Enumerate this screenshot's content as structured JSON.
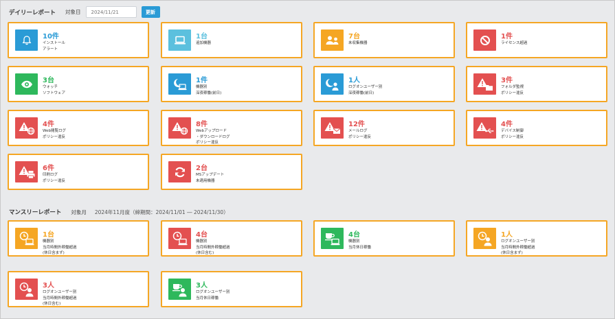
{
  "daily": {
    "title": "デイリーレポート",
    "target_label": "対象日",
    "date_placeholder": "2024/11/21",
    "update_label": "更新"
  },
  "monthly": {
    "title": "マンスリーレポート",
    "target_label": "対象月",
    "period": "2024年11月度（締期間：2024/11/01 ― 2024/11/30）"
  },
  "colors": {
    "red": "#e35050",
    "blue": "#2a9bd6",
    "light_blue": "#5bc0de",
    "orange": "#f5a623",
    "green": "#2eb85c",
    "card_border": "#f5a623"
  },
  "daily_cards": [
    {
      "value": "10件",
      "desc": "インストール\nアラート",
      "color": "blue",
      "icon": "bell-icon"
    },
    {
      "value": "1台",
      "desc": "追加機器",
      "color": "light-blue",
      "icon": "laptop-icon"
    },
    {
      "value": "7台",
      "desc": "未収集機器",
      "color": "orange",
      "icon": "users-icon"
    },
    {
      "value": "1件",
      "desc": "ライセンス超過",
      "color": "red",
      "icon": "ban-icon"
    },
    {
      "value": "3台",
      "desc": "ウォッチ\nソフトウェア",
      "color": "green",
      "icon": "eye-icon"
    },
    {
      "value": "1件",
      "desc": "機器別\n深夜稼働(前日)",
      "color": "blue",
      "icon": "moon-laptop-icon"
    },
    {
      "value": "1人",
      "desc": "ログオンユーザー別\n深夜稼働(前日)",
      "color": "blue",
      "icon": "moon-user-icon"
    },
    {
      "value": "3件",
      "desc": "フォルダ監視\nポリシー違反",
      "color": "red",
      "icon": "warning-folder-icon"
    },
    {
      "value": "4件",
      "desc": "Web閲覧ログ\nポリシー違反",
      "color": "red",
      "icon": "warning-globe-icon"
    },
    {
      "value": "8件",
      "desc": "Webアップロード\n・ダウンロードログ\nポリシー違反",
      "color": "red",
      "icon": "warning-globe-icon"
    },
    {
      "value": "12件",
      "desc": "メールログ\nポリシー違反",
      "color": "red",
      "icon": "warning-mail-icon"
    },
    {
      "value": "4件",
      "desc": "デバイス制御\nポリシー違反",
      "color": "red",
      "icon": "warning-usb-icon"
    },
    {
      "value": "6件",
      "desc": "印刷ログ\nポリシー違反",
      "color": "red",
      "icon": "warning-printer-icon"
    },
    {
      "value": "2台",
      "desc": "MSアップデート\n未適用機器",
      "color": "red",
      "icon": "refresh-icon"
    }
  ],
  "monthly_cards": [
    {
      "value": "1台",
      "desc": "機器別\n当月時間外稼働超過\n(休日含まず)",
      "color": "orange",
      "icon": "clock-laptop-icon"
    },
    {
      "value": "4台",
      "desc": "機器別\n当月時間外稼働超過\n(休日含む)",
      "color": "red",
      "icon": "clock-laptop-icon"
    },
    {
      "value": "4台",
      "desc": "機器別\n当月休日稼働",
      "color": "green",
      "icon": "coffee-laptop-icon"
    },
    {
      "value": "1人",
      "desc": "ログオンユーザー別\n当月時間外稼働超過\n(休日含まず)",
      "color": "orange",
      "icon": "clock-user-icon"
    },
    {
      "value": "3人",
      "desc": "ログオンユーザー別\n当月時間外稼働超過\n(休日含む)",
      "color": "red",
      "icon": "clock-user-icon"
    },
    {
      "value": "3人",
      "desc": "ログオンユーザー別\n当月休日稼働",
      "color": "green",
      "icon": "coffee-user-icon"
    }
  ]
}
